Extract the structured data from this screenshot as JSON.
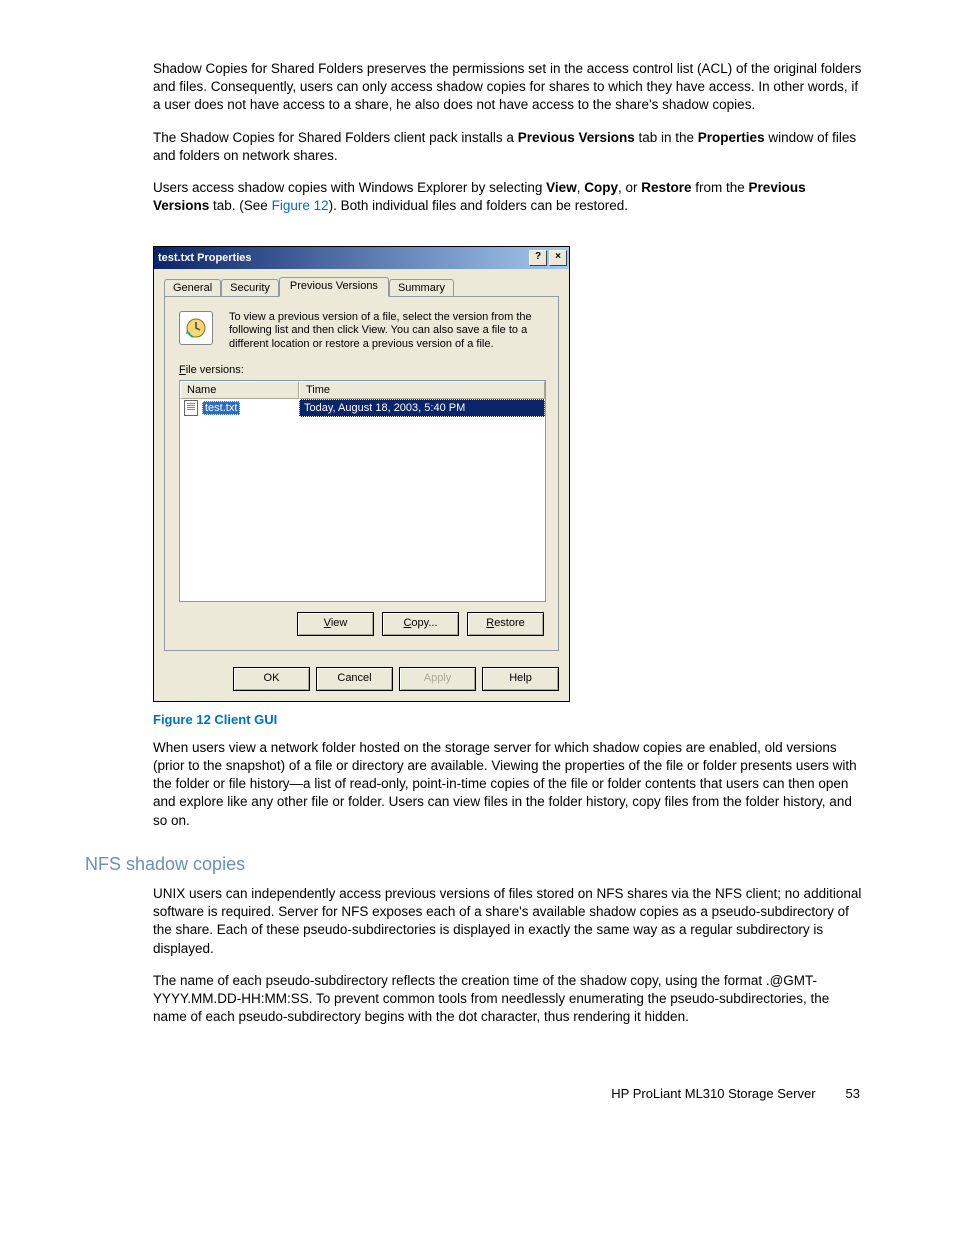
{
  "paragraphs": {
    "p1": "Shadow Copies for Shared Folders preserves the permissions set in the access control list (ACL) of the original folders and files. Consequently, users can only access shadow copies for shares to which they have access. In other words, if a user does not have access to a share, he also does not have access to the share's shadow copies.",
    "p2_a": "The Shadow Copies for Shared Folders client pack installs a ",
    "p2_b1": "Previous Versions",
    "p2_c": " tab in the ",
    "p2_b2": "Properties",
    "p2_d": " window of files and folders on network shares.",
    "p3_a": "Users access shadow copies with Windows Explorer by selecting ",
    "p3_b1": "View",
    "p3_c": ", ",
    "p3_b2": "Copy",
    "p3_d": ", or ",
    "p3_b3": "Restore",
    "p3_e": " from the ",
    "p3_b4": "Previous Versions",
    "p3_f": " tab. (See ",
    "p3_link": "Figure 12",
    "p3_g": "). Both individual files and folders can be restored.",
    "p4": "When users view a network folder hosted on the storage server for which shadow copies are enabled, old versions (prior to the snapshot) of a file or directory are available. Viewing the properties of the file or folder presents users with the folder or file history—a list of read-only, point-in-time copies of the file or folder contents that users can then open and explore like any other file or folder. Users can view files in the folder history, copy files from the folder history, and so on.",
    "p5": "UNIX users can independently access previous versions of files stored on NFS shares via the NFS client; no additional software is required. Server for NFS exposes each of a share's available shadow copies as a pseudo-subdirectory of the share. Each of these pseudo-subdirectories is displayed in exactly the same way as a regular subdirectory is displayed.",
    "p6": "The name of each pseudo-subdirectory reflects the creation time of the shadow copy, using the format .@GMT-YYYY.MM.DD-HH:MM:SS. To prevent common tools from needlessly enumerating the pseudo-subdirectories, the name of each pseudo-subdirectory begins with the dot character, thus rendering it hidden."
  },
  "dialog": {
    "title": "test.txt Properties",
    "help_btn": "?",
    "close_btn": "×",
    "tabs": {
      "general": "General",
      "security": "Security",
      "previous": "Previous Versions",
      "summary": "Summary"
    },
    "instruction": "To view a previous version of a file, select the version from the following list and then click View.  You can also save a file to a different location or restore a previous version of a file.",
    "file_versions_label_u": "F",
    "file_versions_label": "ile versions:",
    "columns": {
      "name": "Name",
      "time": "Time"
    },
    "row": {
      "filename": "test.txt",
      "time": "Today, August 18, 2003, 5:40 PM"
    },
    "pv_buttons": {
      "view": "View",
      "copy": "Copy...",
      "restore": "Restore"
    },
    "dlg_buttons": {
      "ok": "OK",
      "cancel": "Cancel",
      "apply": "Apply",
      "help": "Help"
    }
  },
  "caption": "Figure 12 Client GUI",
  "section_heading": "NFS shadow copies",
  "footer": {
    "product": "HP ProLiant ML310 Storage Server",
    "page": "53"
  }
}
